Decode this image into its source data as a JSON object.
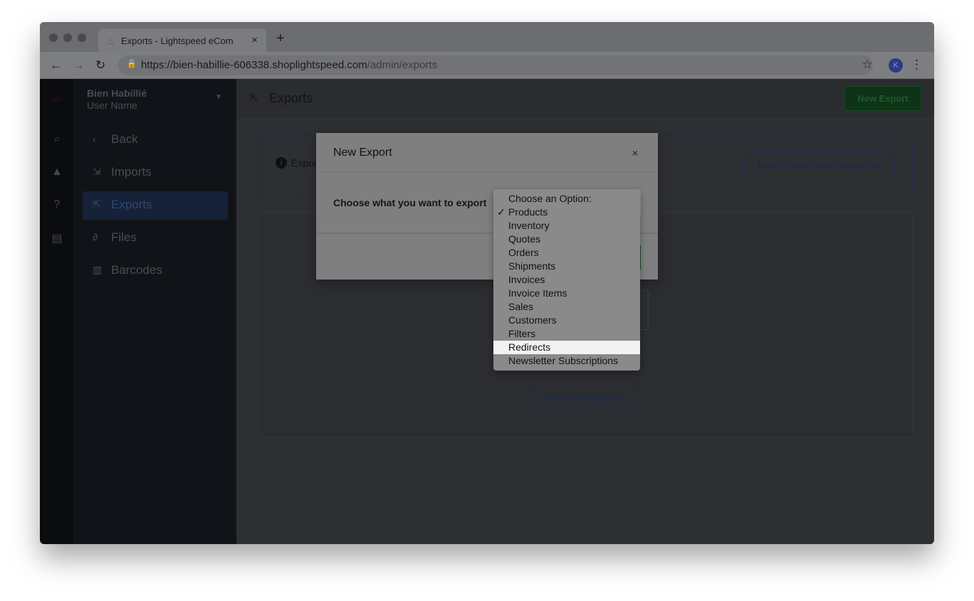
{
  "browser": {
    "tab_title": "Exports - Lightspeed eCom",
    "url_host": "https://bien-habillie-606338.shoplightspeed.com",
    "url_path": "/admin/exports",
    "profile_initial": "K"
  },
  "sidebar": {
    "store_name": "Bien Habillié",
    "user_name": "User Name",
    "items": [
      {
        "label": "Back",
        "icon": "chevron-left"
      },
      {
        "label": "Imports",
        "icon": "import"
      },
      {
        "label": "Exports",
        "icon": "export",
        "active": true
      },
      {
        "label": "Files",
        "icon": "paperclip"
      },
      {
        "label": "Barcodes",
        "icon": "barcode"
      }
    ]
  },
  "header": {
    "title": "Exports",
    "new_export_label": "New Export"
  },
  "info": {
    "text": "Expor",
    "learn_more_label": "Learn more about exporting"
  },
  "card": {
    "start_label": "Start exporting now"
  },
  "modal": {
    "title": "New Export",
    "field_label": "Choose what you want to export",
    "selected": "Products",
    "highlighted": "Redirects",
    "options": [
      "Choose an Option:",
      "Products",
      "Inventory",
      "Quotes",
      "Orders",
      "Shipments",
      "Invoices",
      "Invoice Items",
      "Sales",
      "Customers",
      "Filters",
      "Redirects",
      "Newsletter Subscriptions"
    ]
  },
  "colors": {
    "accent_green": "#1f7a35",
    "brand_red": "#e03a35",
    "overlay": "rgba(0,0,0,0.5)"
  }
}
